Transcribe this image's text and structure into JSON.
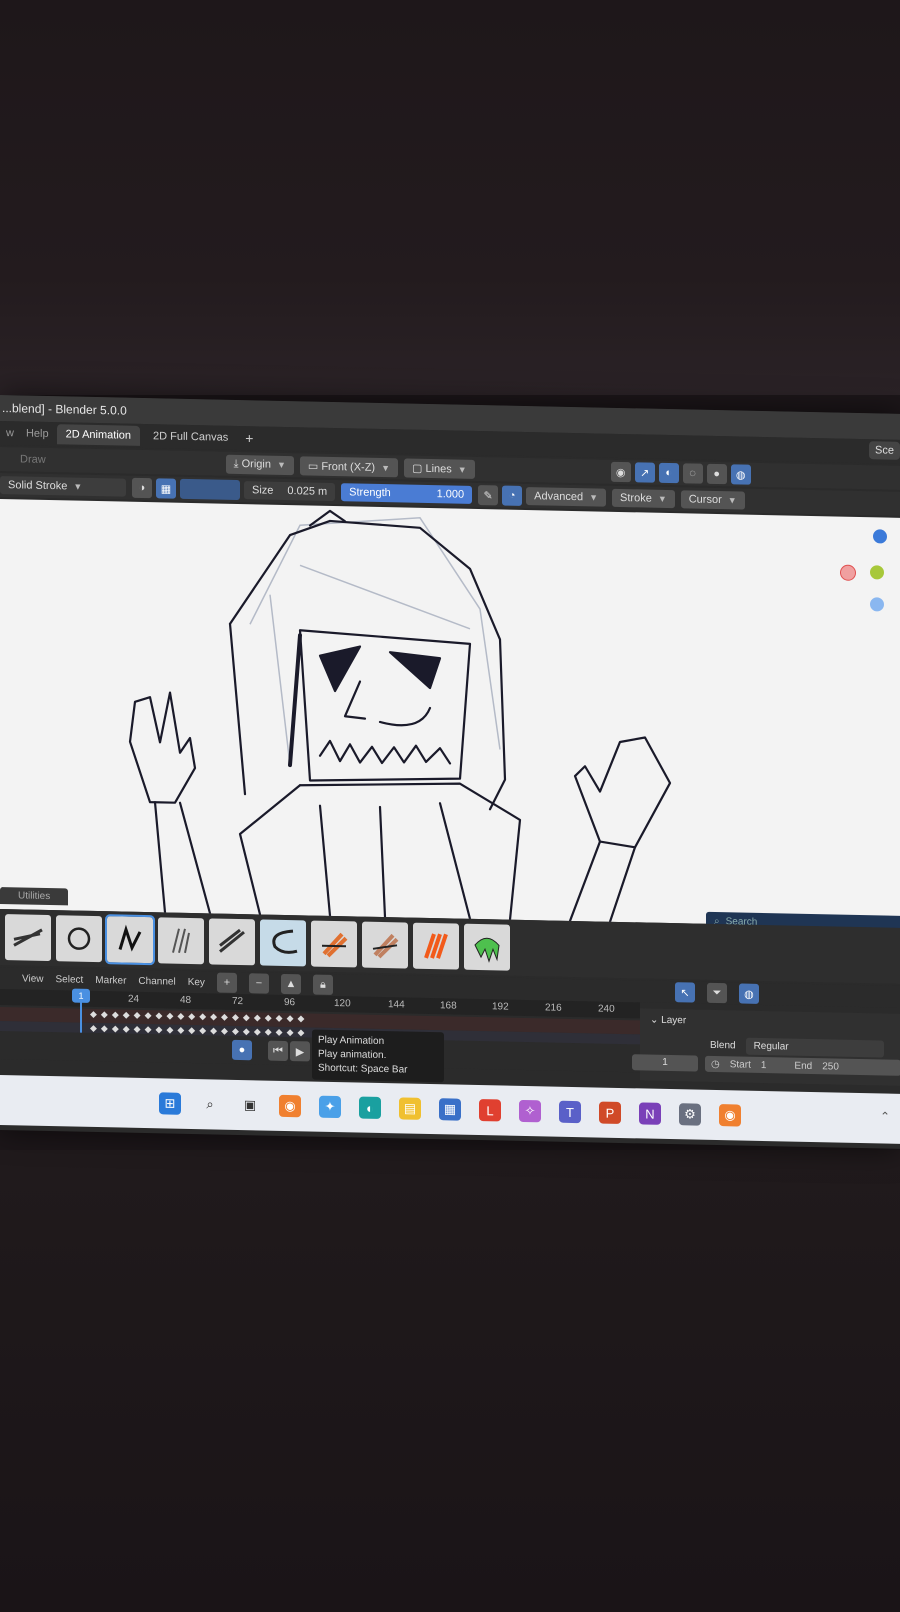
{
  "window": {
    "title": "...blend] - Blender 5.0.0"
  },
  "menu": {
    "items": [
      "w",
      "Help"
    ]
  },
  "workspaces": {
    "tabs": [
      "2D Animation",
      "2D Full Canvas"
    ],
    "active": "2D Animation",
    "add": "+",
    "scene": "Sce"
  },
  "header1": {
    "mode": "Draw",
    "origin": "Origin",
    "view": "Front (X-Z)",
    "lines": "Lines"
  },
  "header2": {
    "stroke_type": "Solid Stroke",
    "size_label": "Size",
    "size_value": "0.025 m",
    "strength_label": "Strength",
    "strength_value": "1.000",
    "advanced": "Advanced",
    "stroke": "Stroke",
    "cursor": "Cursor"
  },
  "brushes": {
    "tab_label": "Utilities",
    "count": 11,
    "selected_index": 2,
    "search_placeholder": "Search"
  },
  "timeline": {
    "menu": [
      "View",
      "Select",
      "Marker",
      "Channel",
      "Key"
    ],
    "ruler": [
      "24",
      "48",
      "72",
      "96",
      "120",
      "144",
      "168",
      "192",
      "216",
      "240"
    ],
    "current_frame": "1",
    "frame_field": "1",
    "start_label": "Start",
    "start_value": "1",
    "end_label": "End",
    "end_value": "250"
  },
  "layer_panel": {
    "title": "Layer",
    "blend_label": "Blend",
    "blend_value": "Regular"
  },
  "tooltip": {
    "title": "Play Animation",
    "desc": "Play animation.",
    "shortcut": "Shortcut: Space Bar"
  },
  "colors": {
    "accent": "#4a7cd4",
    "viewport": "#f3f3f3",
    "panel": "#2b2b2b"
  },
  "taskbar": {
    "icons": [
      "windows-start-icon",
      "search-icon",
      "task-view-icon",
      "blender-icon",
      "copilot-icon",
      "edge-icon",
      "file-explorer-icon",
      "store-icon",
      "app-l-icon",
      "copilot-icon",
      "teams-icon",
      "powerpoint-icon",
      "onenote-icon",
      "settings-icon",
      "blender-icon"
    ]
  }
}
